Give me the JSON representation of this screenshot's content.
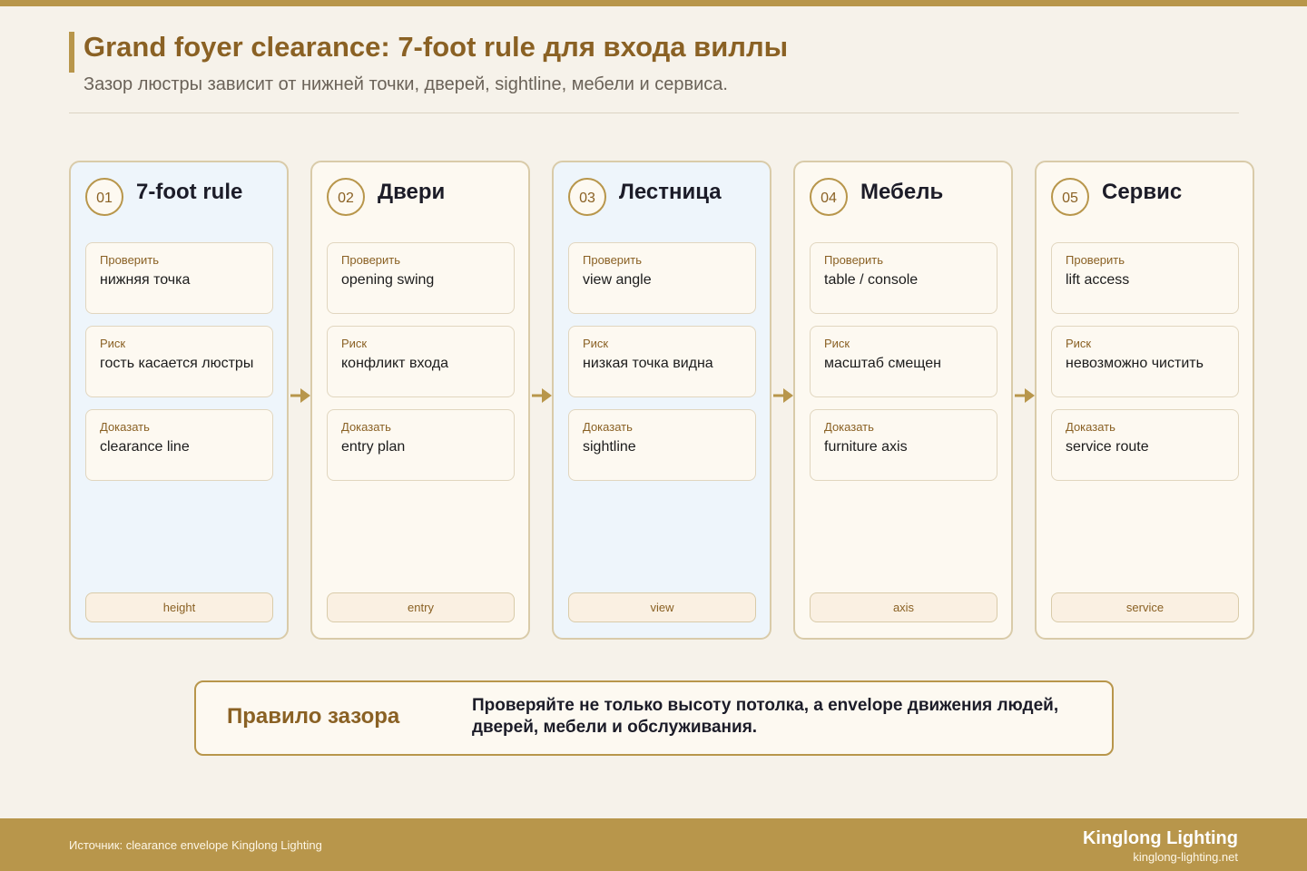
{
  "header": {
    "title": "Grand foyer clearance: 7-foot rule для входа виллы",
    "subtitle": "Зазор люстры зависит от нижней точки, дверей, sightline, мебели и сервиса."
  },
  "labels": {
    "check": "Проверить",
    "risk": "Риск",
    "prove": "Доказать"
  },
  "steps": [
    {
      "num": "01",
      "title": "7-foot rule",
      "check": "нижняя точка",
      "risk": "гость касается люстры",
      "prove": "clearance line",
      "tag": "height"
    },
    {
      "num": "02",
      "title": "Двери",
      "check": "opening swing",
      "risk": "конфликт входа",
      "prove": "entry plan",
      "tag": "entry"
    },
    {
      "num": "03",
      "title": "Лестница",
      "check": "view angle",
      "risk": "низкая точка видна",
      "prove": "sightline",
      "tag": "view"
    },
    {
      "num": "04",
      "title": "Мебель",
      "check": "table / console",
      "risk": "масштаб смещен",
      "prove": "furniture axis",
      "tag": "axis"
    },
    {
      "num": "05",
      "title": "Сервис",
      "check": "lift access",
      "risk": "невозможно чистить",
      "prove": "service route",
      "tag": "service"
    }
  ],
  "rule": {
    "title": "Правило зазора",
    "text": "Проверяйте не только высоту потолка, а envelope движения людей, дверей, мебели и обслуживания."
  },
  "footer": {
    "source": "Источник: clearance envelope Kinglong Lighting",
    "brand": "Kinglong Lighting",
    "url": "kinglong-lighting.net"
  },
  "colors": {
    "accent": "#b8964b",
    "title": "#8a6124",
    "card_blue": "#eef5fb",
    "card_cream": "#fdf9f1"
  }
}
